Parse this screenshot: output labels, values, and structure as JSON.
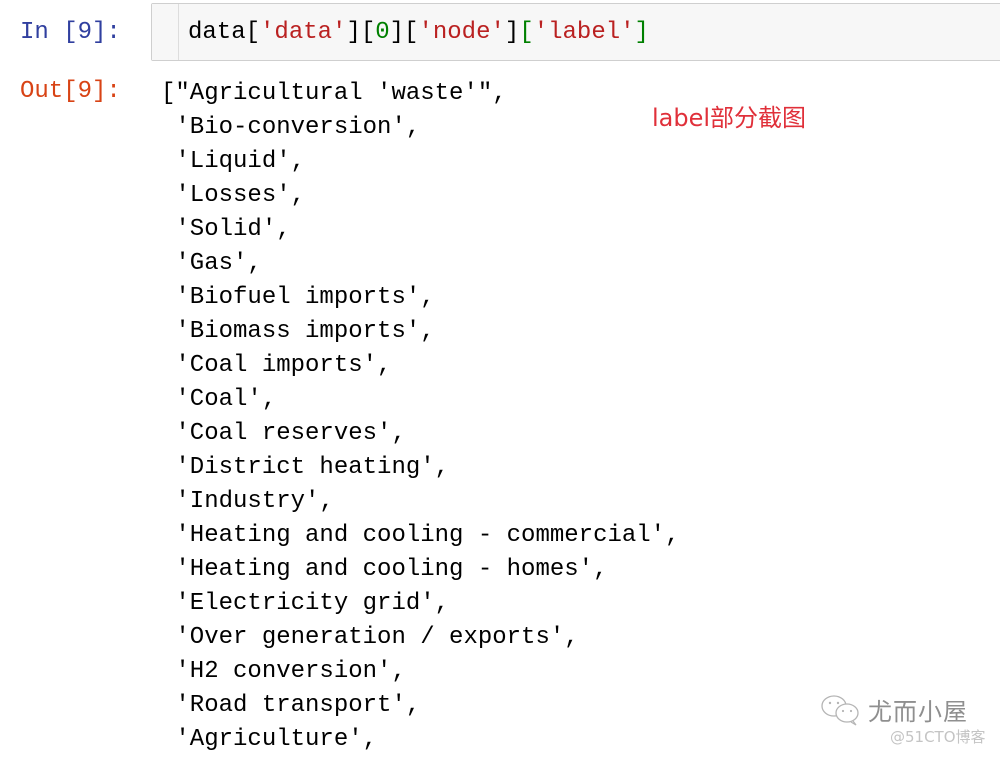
{
  "cell": {
    "in_prompt": "In [9]:",
    "out_prompt": "Out[9]:",
    "code_tokens": [
      {
        "text": "data[",
        "kind": "plain"
      },
      {
        "text": "'data'",
        "kind": "str"
      },
      {
        "text": "][",
        "kind": "plain"
      },
      {
        "text": "0",
        "kind": "num"
      },
      {
        "text": "][",
        "kind": "plain"
      },
      {
        "text": "'node'",
        "kind": "str"
      },
      {
        "text": "]",
        "kind": "plain"
      },
      {
        "text": "[",
        "kind": "bracket-green"
      },
      {
        "text": "'label'",
        "kind": "str"
      },
      {
        "text": "]",
        "kind": "bracket-green"
      }
    ],
    "output_lines": [
      "[\"Agricultural 'waste'\",",
      " 'Bio-conversion',",
      " 'Liquid',",
      " 'Losses',",
      " 'Solid',",
      " 'Gas',",
      " 'Biofuel imports',",
      " 'Biomass imports',",
      " 'Coal imports',",
      " 'Coal',",
      " 'Coal reserves',",
      " 'District heating',",
      " 'Industry',",
      " 'Heating and cooling - commercial',",
      " 'Heating and cooling - homes',",
      " 'Electricity grid',",
      " 'Over generation / exports',",
      " 'H2 conversion',",
      " 'Road transport',",
      " 'Agriculture',"
    ]
  },
  "annotation": {
    "text": "label部分截图",
    "color": "#e0303a"
  },
  "watermark": {
    "icon": "wechat-icon",
    "name": "尤而小屋",
    "site": "@51CTO博客"
  },
  "colors": {
    "in_prompt": "#303f9f",
    "out_prompt": "#d84315",
    "string": "#ba2121",
    "number": "#008000",
    "input_bg": "#f7f7f7"
  }
}
